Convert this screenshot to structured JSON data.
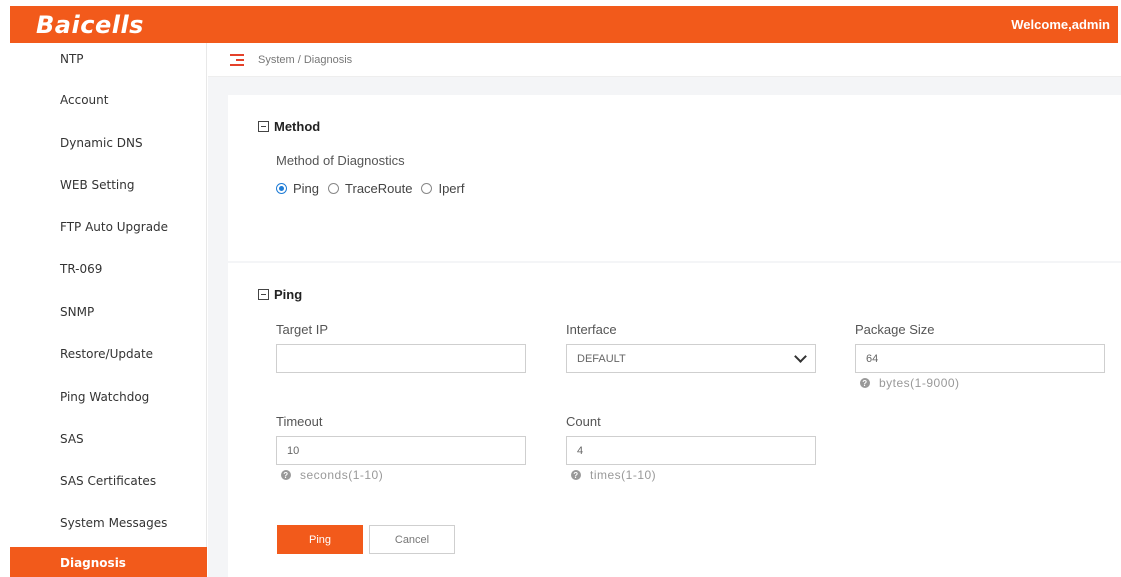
{
  "header": {
    "logo": "Baicells",
    "welcome": "Welcome,admin"
  },
  "sidebar": {
    "items": [
      {
        "label": "NTP"
      },
      {
        "label": "Account"
      },
      {
        "label": "Dynamic DNS"
      },
      {
        "label": "WEB Setting"
      },
      {
        "label": "FTP Auto Upgrade"
      },
      {
        "label": "TR-069"
      },
      {
        "label": "SNMP"
      },
      {
        "label": "Restore/Update"
      },
      {
        "label": "Ping Watchdog"
      },
      {
        "label": "SAS"
      },
      {
        "label": "SAS Certificates"
      },
      {
        "label": "System Messages"
      },
      {
        "label": "Diagnosis"
      }
    ],
    "active": "Diagnosis"
  },
  "breadcrumb": "System / Diagnosis",
  "method_section": {
    "title": "Method",
    "label": "Method of Diagnostics",
    "options": [
      "Ping",
      "TraceRoute",
      "Iperf"
    ],
    "selected": "Ping"
  },
  "ping_section": {
    "title": "Ping",
    "target_ip": {
      "label": "Target IP",
      "value": ""
    },
    "interface": {
      "label": "Interface",
      "value": "DEFAULT"
    },
    "package_size": {
      "label": "Package Size",
      "value": "64",
      "hint": "bytes(1-9000)"
    },
    "timeout": {
      "label": "Timeout",
      "value": "10",
      "hint": "seconds(1-10)"
    },
    "count": {
      "label": "Count",
      "value": "4",
      "hint": "times(1-10)"
    },
    "ping_button": "Ping",
    "cancel_button": "Cancel",
    "help_glyph": "?"
  },
  "colors": {
    "accent": "#f25a1b",
    "radio": "#1f7cd6",
    "menu_icon": "#e4412a"
  },
  "icons": {
    "menu": "menu-icon",
    "collapse": "collapse-icon",
    "help": "help-icon",
    "dropdown": "chevron-down-icon"
  }
}
